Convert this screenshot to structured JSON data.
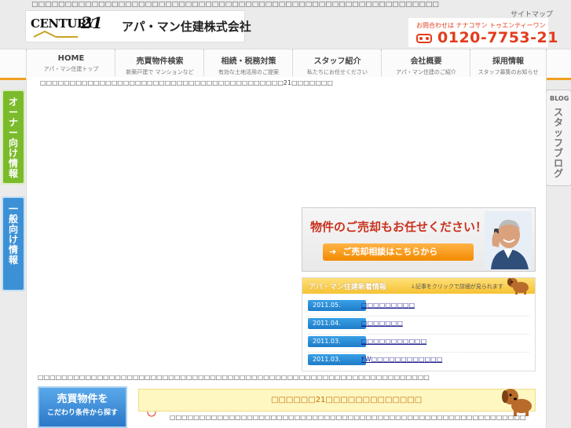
{
  "header": {
    "topline": "□□□□□□□□□□□□□□□□□□□□□□□□□□□□□□□□□□□□□□□□□□□□□□□□□□□□□□□□□□□□□",
    "logo_word": "CENTURY",
    "logo_number": "21",
    "company_name": "アパ・マン住建株式会社",
    "sitemap_label": "サイトマップ",
    "phone_caption": "お問合わせは ナナコサン トゥエンティーワン",
    "phone_number": "0120-7753-21"
  },
  "nav": [
    {
      "title": "HOME",
      "sub": "アパ・マン住建トップ"
    },
    {
      "title": "売買物件検索",
      "sub": "新築戸建で マンションなど"
    },
    {
      "title": "相続・税務対策",
      "sub": "有効な土地活用のご提案"
    },
    {
      "title": "スタッフ紹介",
      "sub": "私たちにお任せください"
    },
    {
      "title": "会社概要",
      "sub": "アパ・マン住建のご紹介"
    },
    {
      "title": "採用情報",
      "sub": "スタッフ募集のお知らせ"
    }
  ],
  "side_tabs": {
    "owner": "オーナー向け情報",
    "general": "一般向け情報",
    "blog_label": "BLOG",
    "blog_text": "スタッフブログ"
  },
  "main": {
    "intro": "□□□□□□□□□□□□□□□□□□□□□□□□□□□□□□□□□□□□□□□□□21□□□□□□□"
  },
  "promo": {
    "heading": "物件のご売却もお任せください！",
    "button_label": "ご売却相談はこちらから",
    "arrow": "➔"
  },
  "news": {
    "title": "アパ・マン住建新着情報",
    "hint": "↓記事をクリックで詳細が見られます",
    "items": [
      {
        "date": "2011.05.",
        "text": "□□□□□□□□□"
      },
      {
        "date": "2011.04.",
        "text": "□□□□□□□"
      },
      {
        "date": "2011.03.",
        "text": "□□□□□□□□□□□"
      },
      {
        "date": "2011.03.",
        "text": "FW□□□□□□□□□□□□"
      }
    ]
  },
  "lower": {
    "band_text": "□□□□□□□□□□□□□□□□□□□□□□□□□□□□□□□□□□□□□□□□□□□□□□□□□□□□□□□□□□□□□□□□□□",
    "search_line1": "売買物件を",
    "search_line2": "こだわり条件から探す",
    "banner_text": "□□□□□□21□□□□□□□□□□□□□",
    "bottom_text": "□□□□□□□□□□□□□□□□□□□□□□□□□□□□□□□□□□□□□□□□□□□□□□□□□□□□□□□□□□□□"
  },
  "colors": {
    "accent_orange": "#f0a020",
    "brand_red": "#e23c1c",
    "green_tab": "#7bbb2b",
    "blue_tab": "#3c91d6"
  }
}
